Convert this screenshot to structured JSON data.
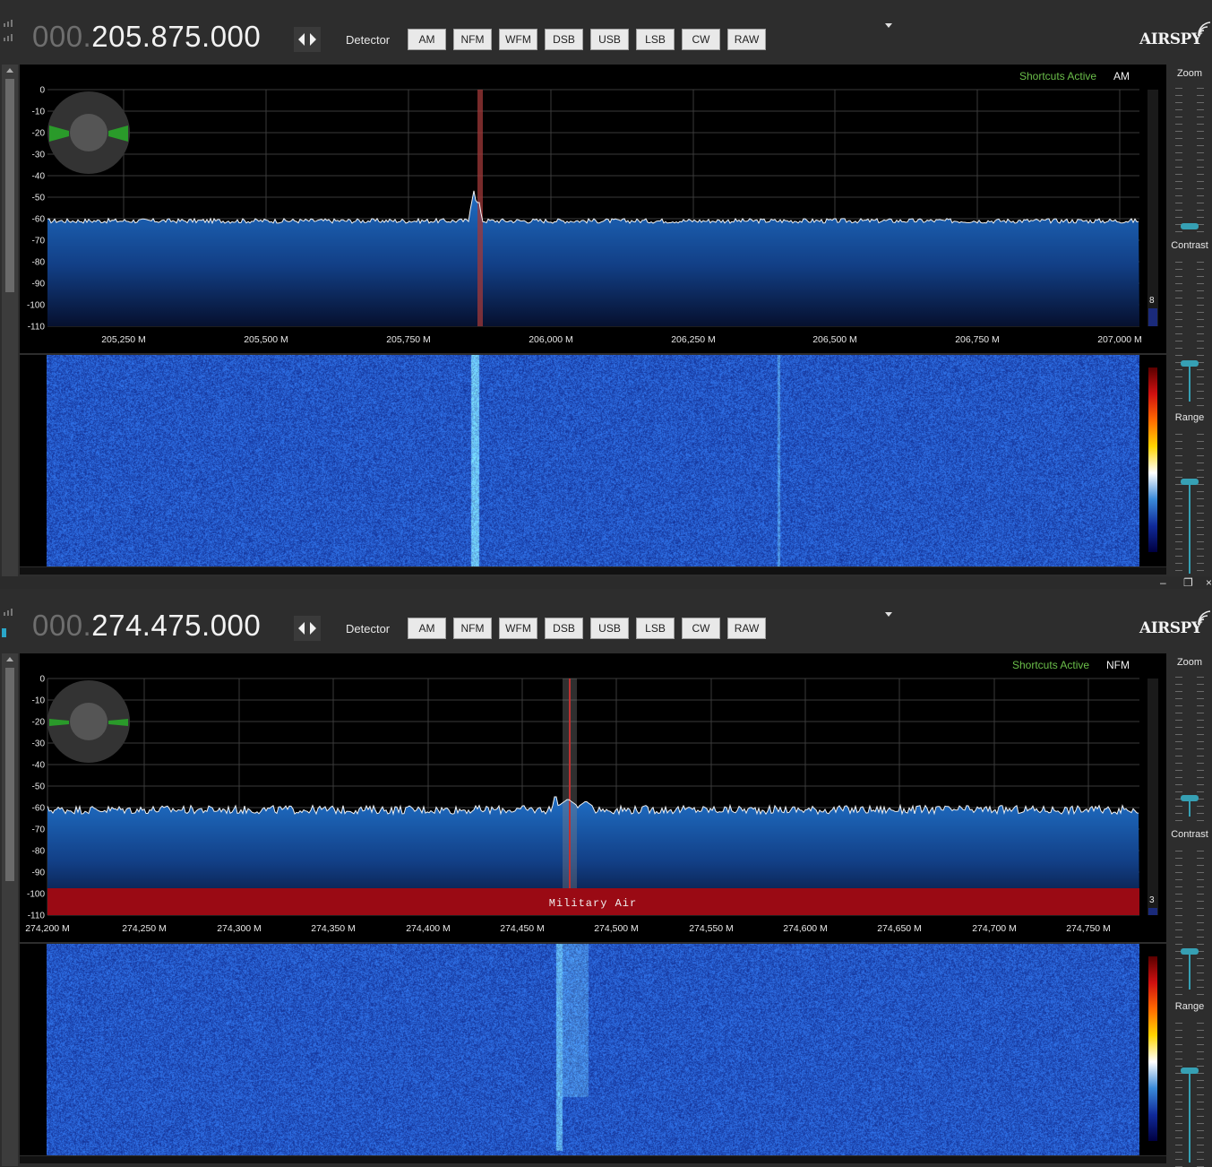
{
  "panels": [
    {
      "frequency": {
        "dim": "000.",
        "bright": "205.875.000"
      },
      "detector_label": "Detector",
      "modes": [
        "AM",
        "NFM",
        "WFM",
        "DSB",
        "USB",
        "LSB",
        "CW",
        "RAW"
      ],
      "logo": "AIRSPY",
      "shortcuts_label": "Shortcuts Active",
      "current_mode": "AM",
      "db_labels": [
        "0",
        "-10",
        "-20",
        "-30",
        "-40",
        "-50",
        "-60",
        "-70",
        "-80",
        "-90",
        "-100",
        "-110"
      ],
      "freq_labels": [
        "205,250 M",
        "205,500 M",
        "205,750 M",
        "206,000 M",
        "206,250 M",
        "206,500 M",
        "206,750 M",
        "207,000 M"
      ],
      "level_value": "8",
      "right_labels": {
        "zoom": "Zoom",
        "contrast": "Contrast",
        "range": "Range"
      },
      "band_label": "",
      "signals": {
        "center_mhz": 205.875,
        "noise_floor_db": -61
      },
      "colors": {
        "accent": "#36a0b4",
        "spectrum_fill": "#1a5fb4",
        "marker": "#b03030"
      }
    },
    {
      "frequency": {
        "dim": "000.",
        "bright": "274.475.000"
      },
      "detector_label": "Detector",
      "modes": [
        "AM",
        "NFM",
        "WFM",
        "DSB",
        "USB",
        "LSB",
        "CW",
        "RAW"
      ],
      "logo": "AIRSPY",
      "shortcuts_label": "Shortcuts Active",
      "current_mode": "NFM",
      "db_labels": [
        "0",
        "-10",
        "-20",
        "-30",
        "-40",
        "-50",
        "-60",
        "-70",
        "-80",
        "-90",
        "-100",
        "-110"
      ],
      "freq_labels": [
        "274,200 M",
        "274,250 M",
        "274,300 M",
        "274,350 M",
        "274,400 M",
        "274,450 M",
        "274,500 M",
        "274,550 M",
        "274,600 M",
        "274,650 M",
        "274,700 M",
        "274,750 M"
      ],
      "level_value": "3",
      "right_labels": {
        "zoom": "Zoom",
        "contrast": "Contrast",
        "range": "Range"
      },
      "band_label": "Military Air",
      "signals": {
        "center_mhz": 274.475,
        "noise_floor_db": -61
      },
      "colors": {
        "accent": "#36a0b4",
        "spectrum_fill": "#1a5fb4",
        "marker": "#b03030",
        "band": "#9a0a14"
      }
    }
  ]
}
